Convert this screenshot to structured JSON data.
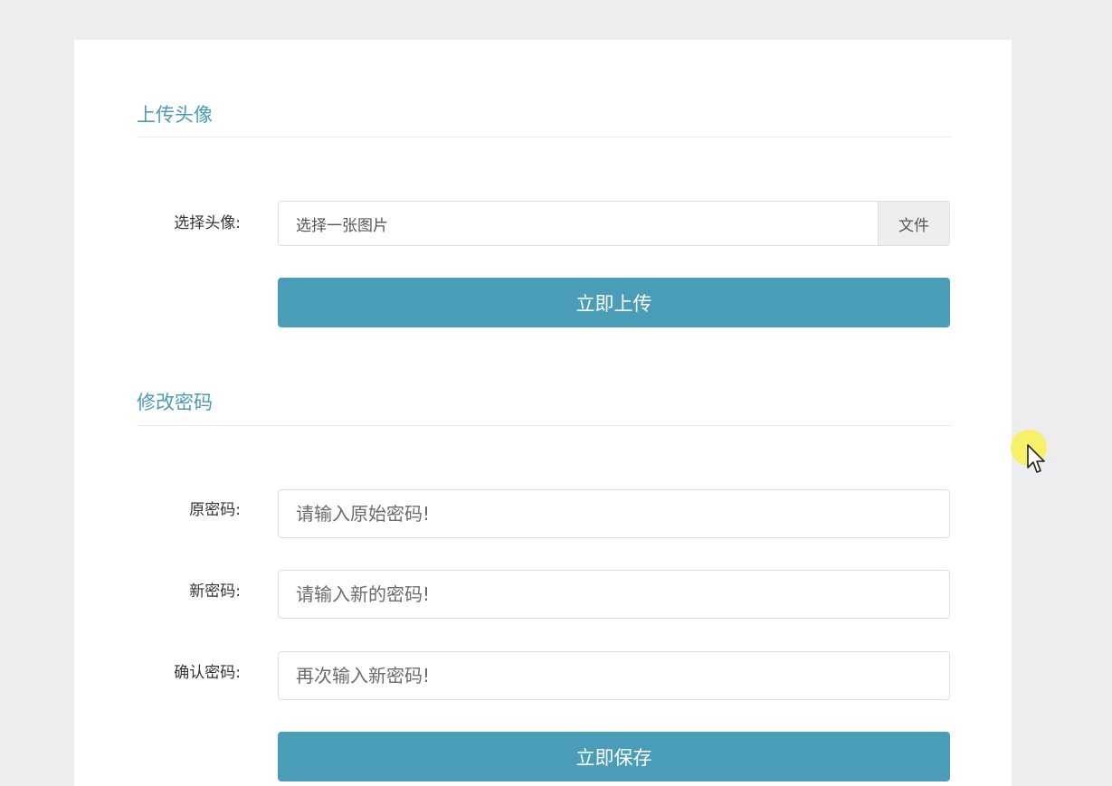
{
  "avatar_section": {
    "title": "上传头像",
    "choose_label": "选择头像:",
    "file_placeholder": "选择一张图片",
    "file_button": "文件",
    "upload_button": "立即上传"
  },
  "password_section": {
    "title": "修改密码",
    "old_password": {
      "label": "原密码:",
      "placeholder": "请输入原始密码!"
    },
    "new_password": {
      "label": "新密码:",
      "placeholder": "请输入新的密码!"
    },
    "confirm_password": {
      "label": "确认密码:",
      "placeholder": "再次输入新密码!"
    },
    "save_button": "立即保存"
  },
  "colors": {
    "accent": "#4a9db8",
    "section_title": "#4a9bb8",
    "page_background": "#ededf0",
    "cursor_highlight": "#f7f05a"
  },
  "icons": {
    "cursor": "mouse-pointer-icon"
  }
}
